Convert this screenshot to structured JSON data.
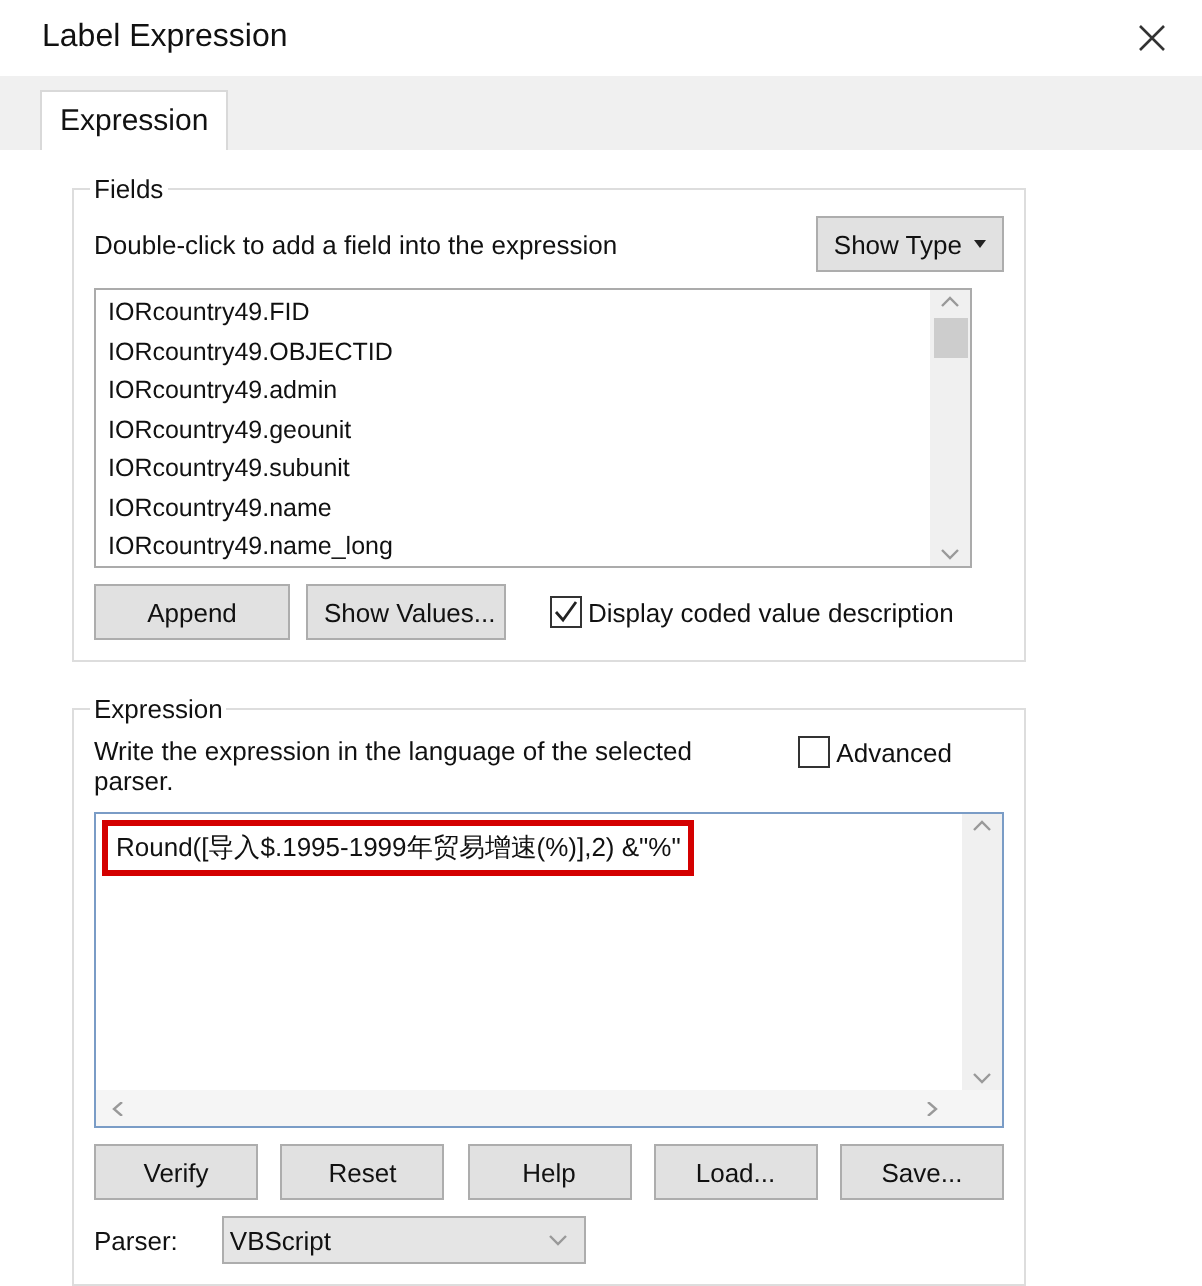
{
  "window": {
    "title": "Label Expression"
  },
  "tabs": [
    {
      "label": "Expression",
      "selected": true
    }
  ],
  "fields": {
    "title": "Fields",
    "hint": "Double-click to add a field into the expression",
    "show_type_button": "Show Type",
    "items": [
      {
        "label": "IORcountry49.FID",
        "selected": false
      },
      {
        "label": "IORcountry49.OBJECTID",
        "selected": false
      },
      {
        "label": "IORcountry49.admin",
        "selected": false
      },
      {
        "label": "IORcountry49.geounit",
        "selected": false
      },
      {
        "label": "IORcountry49.subunit",
        "selected": false
      },
      {
        "label": "IORcountry49.name",
        "selected": false
      },
      {
        "label": "IORcountry49.name_long",
        "selected": false
      }
    ],
    "buttons": [
      "Append",
      "Show Values..."
    ],
    "coded_value": {
      "label": "Display coded value description",
      "checked": true
    }
  },
  "expression": {
    "title": "Expression",
    "hint": "Write the expression in the language of the selected parser.",
    "advanced": {
      "label": "Advanced",
      "checked": false
    },
    "value": "Round([导入$.1995-1999年贸易增速(%)],2) &\"%\"",
    "highlighted": true,
    "buttons": [
      "Verify",
      "Reset",
      "Help",
      "Load...",
      "Save..."
    ],
    "parser_label": "Parser:",
    "parser": "VBScript"
  }
}
